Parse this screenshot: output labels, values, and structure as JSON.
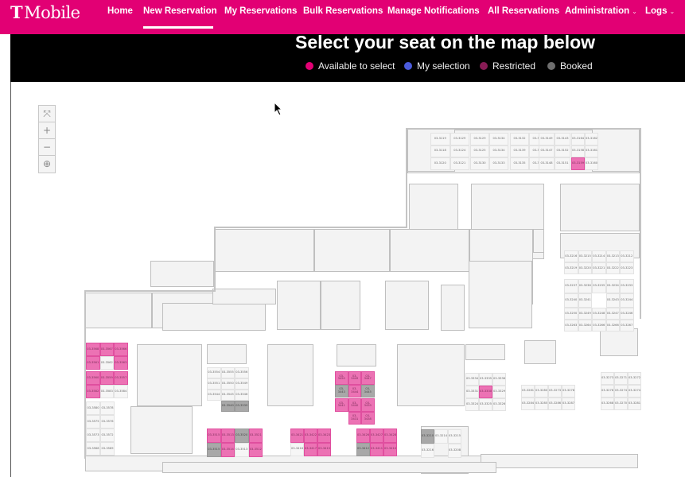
{
  "brand": {
    "t_mark": "T",
    "name": "Mobile"
  },
  "nav": {
    "items": [
      {
        "label": "Home",
        "has_chevron": false,
        "active": false
      },
      {
        "label": "New Reservation",
        "has_chevron": false,
        "active": true
      },
      {
        "label": "My Reservations",
        "has_chevron": false,
        "active": false
      },
      {
        "label": "Bulk Reservations",
        "has_chevron": false,
        "active": false
      },
      {
        "label": "Manage Notifications",
        "has_chevron": false,
        "active": false
      },
      {
        "label": "All Reservations",
        "has_chevron": false,
        "active": false
      },
      {
        "label": "Administration",
        "has_chevron": true,
        "active": false
      },
      {
        "label": "Logs",
        "has_chevron": true,
        "active": false
      }
    ],
    "chevron": "⌄"
  },
  "hero": {
    "title": "Select your seat on the map below",
    "legend": [
      {
        "label": "Available to select",
        "color": "#e20074"
      },
      {
        "label": "My selection",
        "color": "#4b5bdc"
      },
      {
        "label": "Restricted",
        "color": "#861b54"
      },
      {
        "label": "Booked",
        "color": "#6e6e6e"
      }
    ]
  },
  "map_controls": [
    {
      "name": "fit-to-screen-button",
      "icon": "expand-icon",
      "glyph": "⤧"
    },
    {
      "name": "zoom-in-button",
      "icon": "plus-icon",
      "glyph": "+"
    },
    {
      "name": "zoom-out-button",
      "icon": "minus-icon",
      "glyph": "−"
    },
    {
      "name": "zoom-reset-button",
      "icon": "magnifier-icon",
      "glyph": "⊕"
    }
  ],
  "colors": {
    "brand": "#e20074",
    "available": "#ec72b4",
    "booked": "#a8a8a8",
    "open": "#f6f6f6"
  },
  "seat_groups": [
    {
      "id": "north-a",
      "cols": 2,
      "seats": [
        {
          "id": "03-3119",
          "s": "open"
        },
        {
          "id": "03-3129",
          "s": "open"
        },
        {
          "id": "03-3118",
          "s": "open"
        },
        {
          "id": "03-3124",
          "s": "open"
        },
        {
          "id": "03-3120",
          "s": "open"
        },
        {
          "id": "03-3121",
          "s": "open"
        }
      ]
    },
    {
      "id": "north-b",
      "cols": 2,
      "seats": [
        {
          "id": "03-3129",
          "s": "open"
        },
        {
          "id": "03-3134",
          "s": "open"
        },
        {
          "id": "03-3125",
          "s": "open"
        },
        {
          "id": "03-3134",
          "s": "open"
        },
        {
          "id": "03-3130",
          "s": "open"
        },
        {
          "id": "03-3133",
          "s": "open"
        }
      ]
    },
    {
      "id": "north-c",
      "cols": 2,
      "seats": [
        {
          "id": "03-3132",
          "s": "open"
        },
        {
          "id": "03-3144",
          "s": "open"
        },
        {
          "id": "03-3139",
          "s": "open"
        },
        {
          "id": "03-3141",
          "s": "open"
        },
        {
          "id": "03-3135",
          "s": "open"
        },
        {
          "id": "03-3142",
          "s": "open"
        }
      ]
    },
    {
      "id": "north-d",
      "cols": 2,
      "seats": [
        {
          "id": "03-3149",
          "s": "open"
        },
        {
          "id": "03-3143",
          "s": "open"
        },
        {
          "id": "03-3147",
          "s": "open"
        },
        {
          "id": "03-3152",
          "s": "open"
        },
        {
          "id": "03-3148",
          "s": "open"
        },
        {
          "id": "03-3151",
          "s": "open"
        }
      ]
    },
    {
      "id": "north-e",
      "cols": 2,
      "seats": [
        {
          "id": "03-3164",
          "s": "open"
        },
        {
          "id": "03-3162",
          "s": "open"
        },
        {
          "id": "03-3158",
          "s": "open"
        },
        {
          "id": "03-3161",
          "s": "open"
        },
        {
          "id": "03-3159",
          "s": "available"
        },
        {
          "id": "03-3160",
          "s": "open"
        }
      ]
    },
    {
      "id": "east-a",
      "cols": 5,
      "seats": [
        {
          "id": "03-3216",
          "s": "open"
        },
        {
          "id": "03-3215",
          "s": "open"
        },
        {
          "id": "03-3214",
          "s": "open"
        },
        {
          "id": "03-3213",
          "s": "open"
        },
        {
          "id": "03-3212",
          "s": "open"
        },
        {
          "id": "03-3219",
          "s": "open"
        },
        {
          "id": "03-3220",
          "s": "open"
        },
        {
          "id": "03-3221",
          "s": "open"
        },
        {
          "id": "03-3222",
          "s": "open"
        },
        {
          "id": "03-3223",
          "s": "open"
        }
      ]
    },
    {
      "id": "east-b",
      "cols": 5,
      "seats": [
        {
          "id": "03-3237",
          "s": "open"
        },
        {
          "id": "03-3236",
          "s": "open"
        },
        {
          "id": "03-3235",
          "s": "open"
        },
        {
          "id": "03-3234",
          "s": "open"
        },
        {
          "id": "03-3233",
          "s": "open"
        },
        {
          "id": "03-3240",
          "s": "open"
        },
        {
          "id": "03-3241",
          "s": "open"
        },
        {
          "id": "",
          "s": "gap"
        },
        {
          "id": "03-3243",
          "s": "open"
        },
        {
          "id": "03-3244",
          "s": "open"
        }
      ]
    },
    {
      "id": "east-c",
      "cols": 5,
      "seats": [
        {
          "id": "03-3250",
          "s": "open"
        },
        {
          "id": "03-3249",
          "s": "open"
        },
        {
          "id": "03-3248",
          "s": "open"
        },
        {
          "id": "03-3247",
          "s": "open"
        },
        {
          "id": "03-3246",
          "s": "open"
        },
        {
          "id": "03-3263",
          "s": "open"
        },
        {
          "id": "03-3264",
          "s": "open"
        },
        {
          "id": "03-3266",
          "s": "open"
        },
        {
          "id": "03-3266",
          "s": "open"
        },
        {
          "id": "03-3267",
          "s": "open"
        }
      ]
    },
    {
      "id": "west-a",
      "cols": 3,
      "seats": [
        {
          "id": "03-3568",
          "s": "available"
        },
        {
          "id": "03-3567",
          "s": "available"
        },
        {
          "id": "03-3566",
          "s": "available"
        },
        {
          "id": "03-3561",
          "s": "available"
        },
        {
          "id": "03-3562",
          "s": "open"
        },
        {
          "id": "03-3563",
          "s": "available"
        }
      ]
    },
    {
      "id": "west-b",
      "cols": 3,
      "seats": [
        {
          "id": "03-3560",
          "s": "available"
        },
        {
          "id": "03-3559",
          "s": "available"
        },
        {
          "id": "03-3557",
          "s": "available"
        },
        {
          "id": "03-3582",
          "s": "available"
        },
        {
          "id": "03-3583",
          "s": "open"
        },
        {
          "id": "03-3584",
          "s": "open"
        }
      ]
    },
    {
      "id": "west-c",
      "cols": 2,
      "seats": [
        {
          "id": "03-3580",
          "s": "open"
        },
        {
          "id": "03-3578",
          "s": "open"
        },
        {
          "id": "03-3575",
          "s": "open"
        },
        {
          "id": "03-3576",
          "s": "open"
        }
      ]
    },
    {
      "id": "west-d",
      "cols": 2,
      "seats": [
        {
          "id": "03-3573",
          "s": "open"
        },
        {
          "id": "03-3572",
          "s": "open"
        },
        {
          "id": "03-3568",
          "s": "open"
        },
        {
          "id": "03-3569",
          "s": "open"
        }
      ]
    },
    {
      "id": "center-a",
      "cols": 3,
      "seats": [
        {
          "id": "03-3554",
          "s": "open"
        },
        {
          "id": "03-3555",
          "s": "open"
        },
        {
          "id": "03-3556",
          "s": "open"
        },
        {
          "id": "03-3551",
          "s": "open"
        },
        {
          "id": "03-3550",
          "s": "open"
        },
        {
          "id": "03-3549",
          "s": "open"
        },
        {
          "id": "03-3544",
          "s": "open"
        },
        {
          "id": "03-3545",
          "s": "open"
        },
        {
          "id": "03-3546",
          "s": "open"
        },
        {
          "id": "",
          "s": "gap"
        },
        {
          "id": "03-3540",
          "s": "booked"
        },
        {
          "id": "03-3539",
          "s": "booked"
        }
      ]
    },
    {
      "id": "center-b",
      "cols": 4,
      "seats": [
        {
          "id": "03-3515",
          "s": "available"
        },
        {
          "id": "03-3513",
          "s": "available"
        },
        {
          "id": "03-3520",
          "s": "booked"
        },
        {
          "id": "03-3521",
          "s": "available"
        },
        {
          "id": "03-3515",
          "s": "booked"
        },
        {
          "id": "03-3514",
          "s": "available"
        },
        {
          "id": "03-3513",
          "s": "open"
        },
        {
          "id": "03-3512",
          "s": "available"
        }
      ]
    },
    {
      "id": "mid-a",
      "cols": 3,
      "seats": [
        {
          "id": "03-3450",
          "s": "available"
        },
        {
          "id": "03-3449",
          "s": "available"
        },
        {
          "id": "03-3447",
          "s": "available"
        },
        {
          "id": "03-3443",
          "s": "booked"
        },
        {
          "id": "03-3444",
          "s": "available"
        },
        {
          "id": "03-3445",
          "s": "booked"
        }
      ]
    },
    {
      "id": "mid-b",
      "cols": 3,
      "seats": [
        {
          "id": "03-3441",
          "s": "available"
        },
        {
          "id": "03-3440",
          "s": "available"
        },
        {
          "id": "03-3439",
          "s": "available"
        },
        {
          "id": "",
          "s": "gap"
        },
        {
          "id": "03-3431",
          "s": "available"
        },
        {
          "id": "03-3438",
          "s": "available"
        }
      ]
    },
    {
      "id": "mid-c",
      "cols": 3,
      "seats": [
        {
          "id": "03-3421",
          "s": "available"
        },
        {
          "id": "03-3422",
          "s": "available"
        },
        {
          "id": "03-3423",
          "s": "available"
        },
        {
          "id": "03-3416",
          "s": "open"
        },
        {
          "id": "03-3417",
          "s": "available"
        },
        {
          "id": "03-3415",
          "s": "available"
        }
      ]
    },
    {
      "id": "mid-d",
      "cols": 3,
      "seats": [
        {
          "id": "03-3426",
          "s": "available"
        },
        {
          "id": "03-3427",
          "s": "available"
        },
        {
          "id": "03-3428",
          "s": "available"
        },
        {
          "id": "03-3412",
          "s": "booked"
        },
        {
          "id": "03-3411",
          "s": "available"
        },
        {
          "id": "03-3410",
          "s": "available"
        }
      ]
    },
    {
      "id": "se-a",
      "cols": 3,
      "seats": [
        {
          "id": "03-3334",
          "s": "open"
        },
        {
          "id": "03-3335",
          "s": "open"
        },
        {
          "id": "03-3336",
          "s": "open"
        },
        {
          "id": "03-3331",
          "s": "open"
        },
        {
          "id": "03-3330",
          "s": "available"
        },
        {
          "id": "03-3329",
          "s": "open"
        },
        {
          "id": "03-3324",
          "s": "open"
        },
        {
          "id": "03-3325",
          "s": "open"
        },
        {
          "id": "03-3326",
          "s": "open"
        }
      ]
    },
    {
      "id": "se-b",
      "cols": 3,
      "seats": [
        {
          "id": "03-3210",
          "s": "booked"
        },
        {
          "id": "03-3214",
          "s": "open"
        },
        {
          "id": "03-3215",
          "s": "open"
        },
        {
          "id": "03-3216",
          "s": "open"
        },
        {
          "id": "",
          "s": "gap"
        },
        {
          "id": "03-3208",
          "s": "open"
        }
      ]
    },
    {
      "id": "se-c",
      "cols": 4,
      "seats": [
        {
          "id": "03-3281",
          "s": "open"
        },
        {
          "id": "03-3280",
          "s": "open"
        },
        {
          "id": "03-3273",
          "s": "open"
        },
        {
          "id": "03-3278",
          "s": "open"
        },
        {
          "id": "03-3284",
          "s": "open"
        },
        {
          "id": "03-3285",
          "s": "open"
        },
        {
          "id": "03-3286",
          "s": "open"
        },
        {
          "id": "03-3287",
          "s": "open"
        }
      ]
    },
    {
      "id": "se-d",
      "cols": 3,
      "seats": [
        {
          "id": "03-3273",
          "s": "open"
        },
        {
          "id": "03-3271",
          "s": "open"
        },
        {
          "id": "03-3272",
          "s": "open"
        },
        {
          "id": "03-3276",
          "s": "open"
        },
        {
          "id": "03-3274",
          "s": "open"
        },
        {
          "id": "03-3274",
          "s": "open"
        },
        {
          "id": "03-3268",
          "s": "open"
        },
        {
          "id": "03-3270",
          "s": "open"
        },
        {
          "id": "03-3281",
          "s": "open"
        }
      ]
    }
  ]
}
